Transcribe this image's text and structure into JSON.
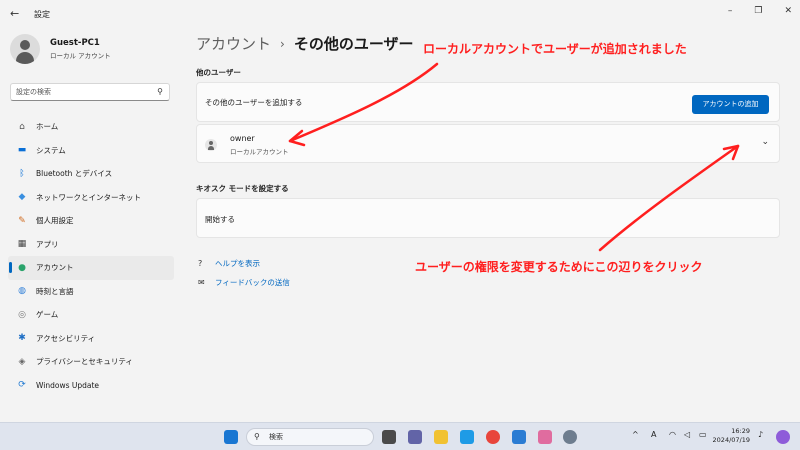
{
  "window": {
    "back_glyph": "←",
    "title": "設定",
    "controls": [
      "–",
      "❐",
      "✕"
    ]
  },
  "user": {
    "name": "Guest-PC1",
    "type": "ローカル アカウント"
  },
  "search": {
    "placeholder": "設定の検索",
    "icon": "search-icon"
  },
  "nav": [
    {
      "label": "ホーム",
      "icon": "home-icon",
      "glyph": "⌂",
      "color": "#555555"
    },
    {
      "label": "システム",
      "icon": "system-icon",
      "glyph": "▬",
      "color": "#0a6fd6"
    },
    {
      "label": "Bluetooth とデバイス",
      "icon": "bluetooth-icon",
      "glyph": "ᛒ",
      "color": "#0a6fd6"
    },
    {
      "label": "ネットワークとインターネット",
      "icon": "network-icon",
      "glyph": "◆",
      "color": "#3a8fe0"
    },
    {
      "label": "個人用設定",
      "icon": "personalization-icon",
      "glyph": "✎",
      "color": "#d06a1e"
    },
    {
      "label": "アプリ",
      "icon": "apps-icon",
      "glyph": "▦",
      "color": "#444444"
    },
    {
      "label": "アカウント",
      "icon": "account-icon",
      "glyph": "●",
      "color": "#2aa36b",
      "active": true
    },
    {
      "label": "時刻と言語",
      "icon": "time-language-icon",
      "glyph": "◍",
      "color": "#2f7fd8"
    },
    {
      "label": "ゲーム",
      "icon": "gaming-icon",
      "glyph": "◎",
      "color": "#777777"
    },
    {
      "label": "アクセシビリティ",
      "icon": "accessibility-icon",
      "glyph": "✱",
      "color": "#1f6fc5"
    },
    {
      "label": "プライバシーとセキュリティ",
      "icon": "privacy-shield-icon",
      "glyph": "◈",
      "color": "#666666"
    },
    {
      "label": "Windows Update",
      "icon": "windows-update-icon",
      "glyph": "⟳",
      "color": "#1f78d1"
    }
  ],
  "breadcrumb": {
    "parent": "アカウント",
    "separator": "›",
    "current": "その他のユーザー"
  },
  "other_users": {
    "heading": "他のユーザー",
    "add_label": "その他のユーザーを追加する",
    "add_button": "アカウントの追加",
    "owner_name": "owner",
    "owner_type": "ローカルアカウント",
    "chevron": "⌄"
  },
  "kiosk": {
    "heading": "キオスク モードを設定する",
    "start_label": "開始する"
  },
  "links": {
    "help": "ヘルプを表示",
    "feedback": "フィードバックの送信"
  },
  "annotations": {
    "top": "ローカルアカウントでユーザーが追加されました",
    "bottom": "ユーザーの権限を変更するためにこの辺りをクリック",
    "color": "#ff1f1f"
  },
  "taskbar": {
    "search_label": "検索",
    "time": "16:29",
    "date": "2024/07/19",
    "ime": "A"
  }
}
